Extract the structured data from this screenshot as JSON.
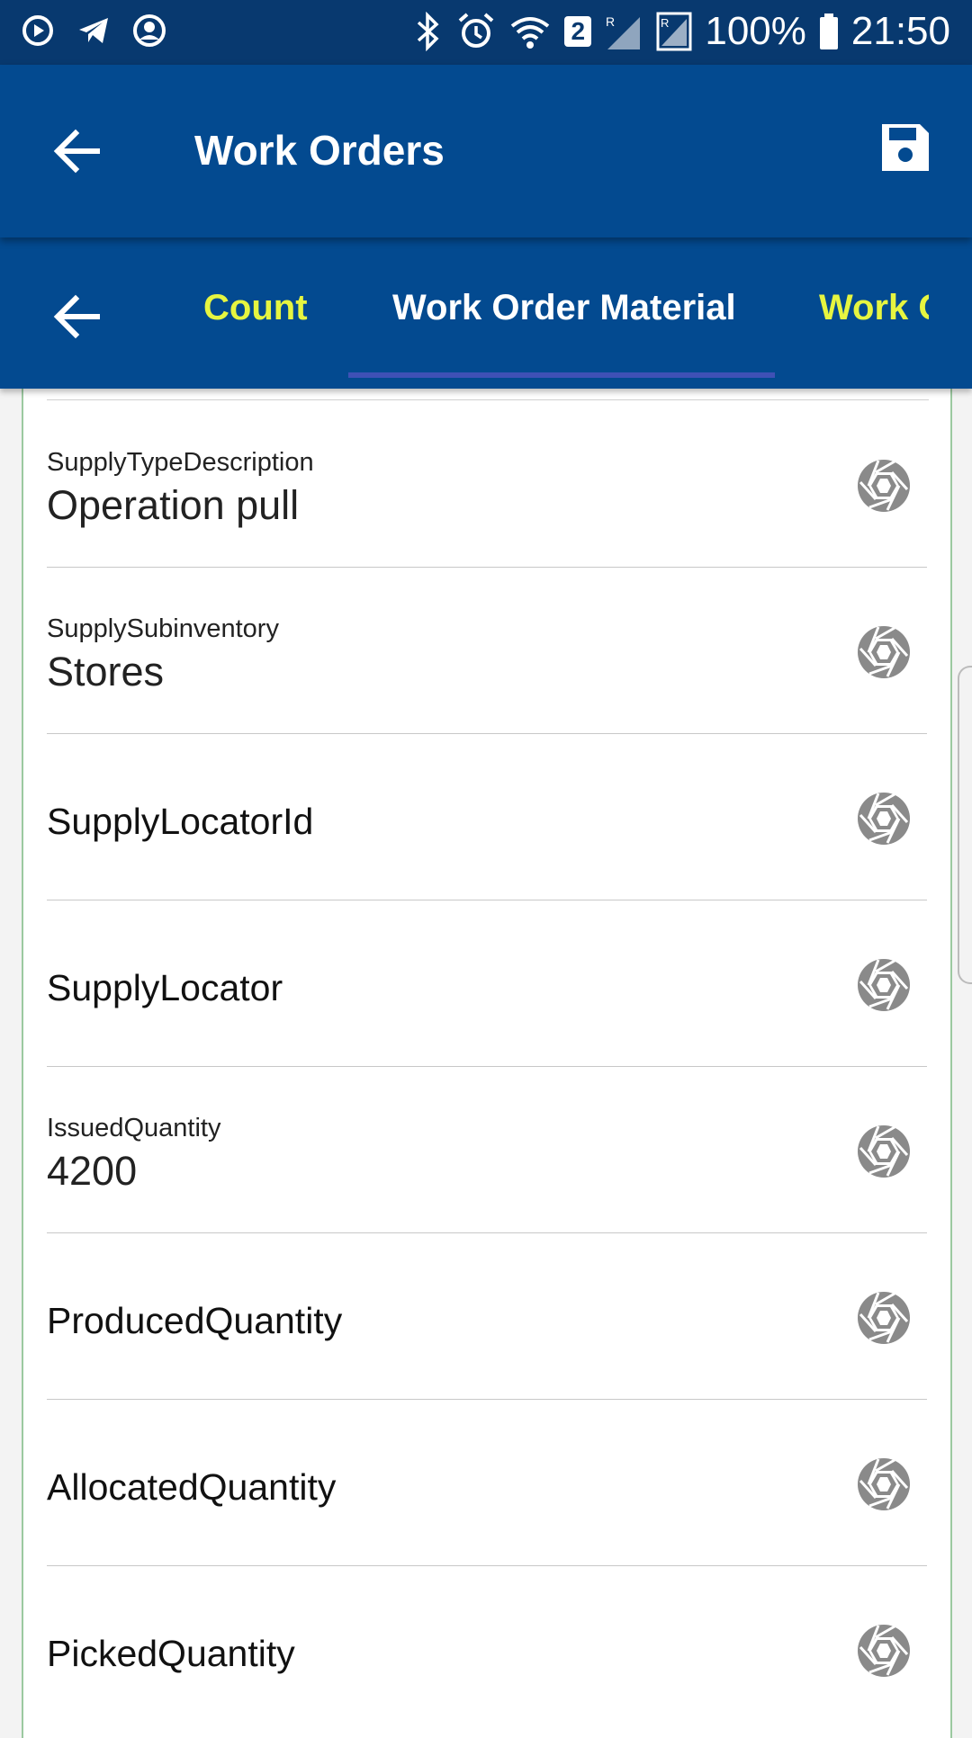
{
  "status_bar": {
    "battery_percent": "100%",
    "time": "21:50",
    "badge": "2",
    "left_icons": [
      "play-circle-icon",
      "telegram-icon",
      "account-icon"
    ],
    "right_icons": [
      "bluetooth-icon",
      "alarm-icon",
      "wifi-icon",
      "signal-icon",
      "battery-icon"
    ]
  },
  "app_bar": {
    "title": "Work Orders",
    "back_icon": "arrow-left-icon",
    "save_icon": "save-icon"
  },
  "tabs": [
    {
      "label": "Count",
      "active": false
    },
    {
      "label": "Work Order Material",
      "active": true
    },
    {
      "label": "Work Order Operation",
      "active": false
    }
  ],
  "fields": [
    {
      "label": "SupplyTypeDescription",
      "value": "Operation pull"
    },
    {
      "label": "SupplySubinventory",
      "value": "Stores"
    },
    {
      "label": "SupplyLocatorId",
      "value": ""
    },
    {
      "label": "SupplyLocator",
      "value": ""
    },
    {
      "label": "IssuedQuantity",
      "value": "4200"
    },
    {
      "label": "ProducedQuantity",
      "value": ""
    },
    {
      "label": "AllocatedQuantity",
      "value": ""
    },
    {
      "label": "PickedQuantity",
      "value": ""
    }
  ],
  "colors": {
    "app_bar": "#034a90",
    "status_bar": "#08396f",
    "tab_inactive": "#e6f540",
    "tab_indicator": "#3f51b5",
    "aperture_icon": "#8a8a8a"
  }
}
